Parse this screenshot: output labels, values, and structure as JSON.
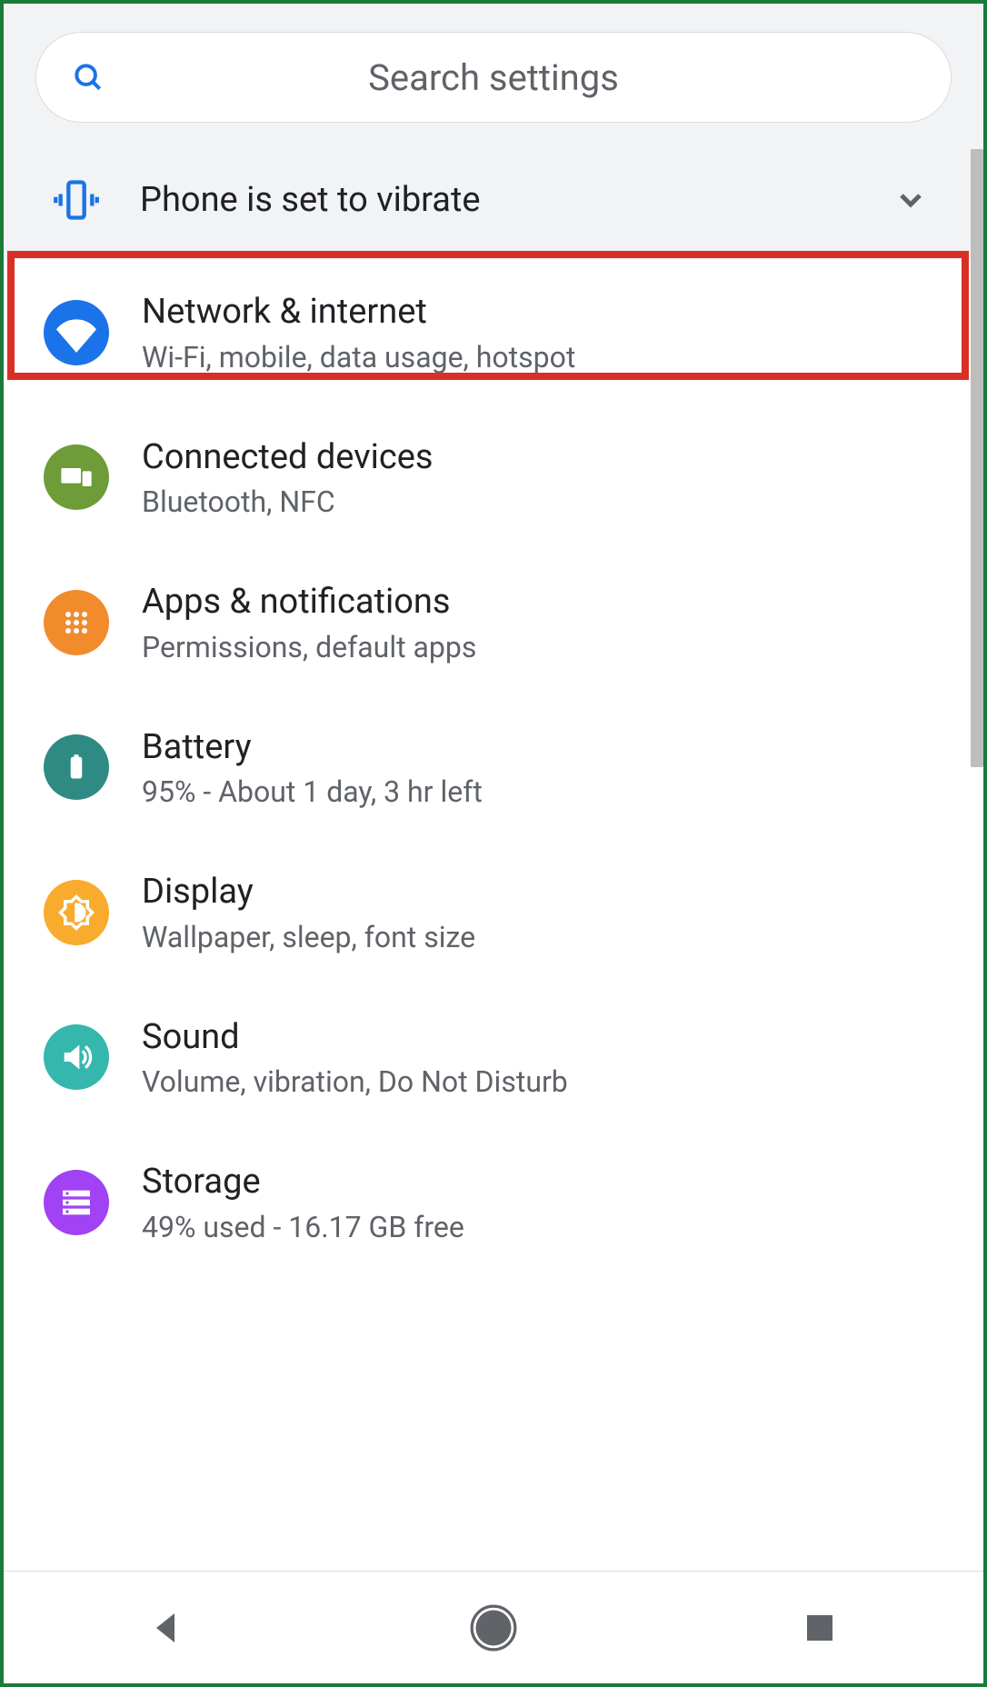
{
  "search": {
    "placeholder": "Search settings"
  },
  "banner": {
    "text": "Phone is set to vibrate"
  },
  "items": [
    {
      "title": "Network & internet",
      "sub": "Wi-Fi, mobile, data usage, hotspot",
      "color": "#1a73e8",
      "icon": "wifi"
    },
    {
      "title": "Connected devices",
      "sub": "Bluetooth, NFC",
      "color": "#6d9c38",
      "icon": "devices"
    },
    {
      "title": "Apps & notifications",
      "sub": "Permissions, default apps",
      "color": "#f28b2c",
      "icon": "apps"
    },
    {
      "title": "Battery",
      "sub": "95% - About 1 day, 3 hr left",
      "color": "#2f8a84",
      "icon": "battery"
    },
    {
      "title": "Display",
      "sub": "Wallpaper, sleep, font size",
      "color": "#f9ab2d",
      "icon": "brightness"
    },
    {
      "title": "Sound",
      "sub": "Volume, vibration, Do Not Disturb",
      "color": "#35b7ad",
      "icon": "sound"
    },
    {
      "title": "Storage",
      "sub": "49% used - 16.17 GB free",
      "color": "#a142f4",
      "icon": "storage"
    }
  ],
  "highlighted_index": 0
}
